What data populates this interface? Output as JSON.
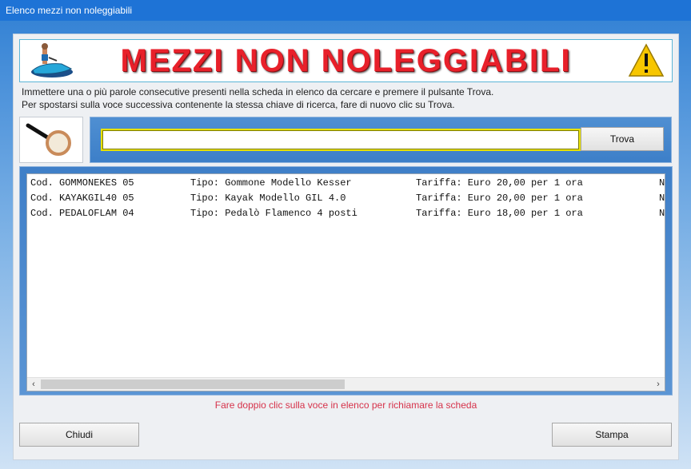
{
  "window": {
    "title": "Elenco mezzi non noleggiabili"
  },
  "header": {
    "title": "MEZZI NON NOLEGGIABILI",
    "left_icon": "jetski-icon",
    "right_icon": "warning-icon"
  },
  "instructions": {
    "line1": "Immettere una o più parole consecutive presenti nella scheda in elenco da cercare e premere il pulsante Trova.",
    "line2": "Per spostarsi sulla voce successiva contenente la stessa chiave di ricerca, fare di nuovo clic su Trova."
  },
  "search": {
    "value": "",
    "button_label": "Trova",
    "icon": "magnifying-glass-icon"
  },
  "list": {
    "rows": [
      {
        "code": "Cod. GOMMONEKES 05",
        "type": "Tipo: Gommone Modello Kesser",
        "rate": "Tariffa: Euro 20,00 per 1 ora",
        "extra": "N"
      },
      {
        "code": "Cod. KAYAKGIL40 05",
        "type": "Tipo: Kayak Modello GIL 4.0",
        "rate": "Tariffa: Euro 20,00 per 1 ora",
        "extra": "N"
      },
      {
        "code": "Cod. PEDALOFLAM 04",
        "type": "Tipo: Pedalò Flamenco 4 posti",
        "rate": "Tariffa: Euro 18,00 per 1 ora",
        "extra": "N"
      }
    ],
    "scroll_left": "‹",
    "scroll_right": "›"
  },
  "hint": "Fare doppio clic sulla voce in elenco per richiamare la scheda",
  "footer": {
    "close_label": "Chiudi",
    "print_label": "Stampa"
  },
  "colors": {
    "accent_title": "#e8202a",
    "hint": "#d6324a",
    "search_border": "#e8e000",
    "titlebar": "#1e73d6"
  }
}
